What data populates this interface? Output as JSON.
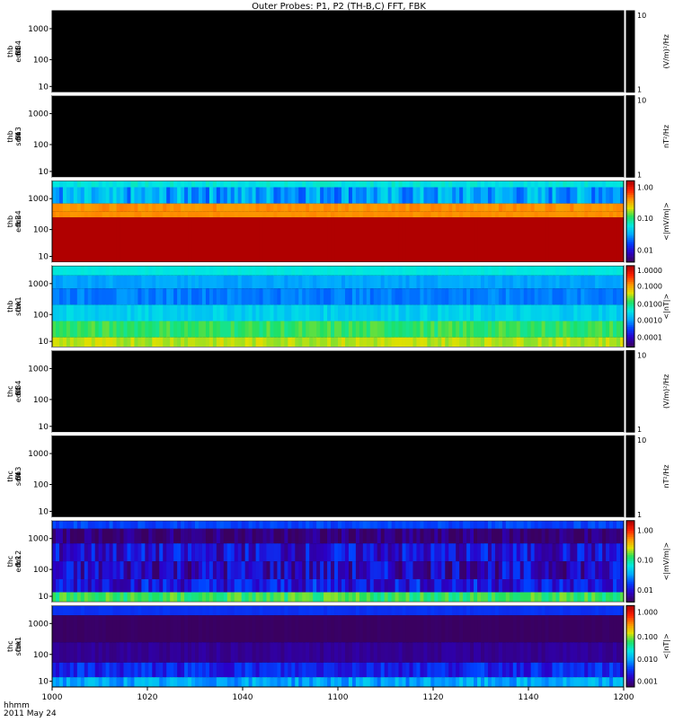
{
  "title": "Outer Probes: P1, P2 (TH-B,C) FFT, FBK",
  "footer": {
    "time_label": "hhmm",
    "date_label": "2011 May 24"
  },
  "colors": {
    "background": "#000000",
    "separator": "#ffffff",
    "colormap": [
      "#3a0060",
      "#2a00c8",
      "#0040ff",
      "#00a8ff",
      "#00e8e0",
      "#20e060",
      "#e0e000",
      "#ff9000",
      "#ff2000",
      "#b00000"
    ]
  },
  "chart_data": {
    "type": "heatmap",
    "x_axis": {
      "range": [
        "1000",
        "1200"
      ],
      "tick_labels": [
        "1000",
        "1020",
        "1040",
        "1100",
        "1120",
        "1140",
        "1200"
      ]
    },
    "panels": [
      {
        "id": "thb-fff-edc34",
        "ylabel": [
          "thb",
          "fff",
          "64",
          "edc34"
        ],
        "yscale": "log",
        "yticks": [
          "1000",
          "100",
          "10"
        ],
        "colorbar": {
          "label": "(V/m)²/Hz",
          "tick_labels": [
            "10",
            "1"
          ],
          "tick_fracs": [
            0.0,
            1.0
          ],
          "gradient": false
        },
        "data": "empty"
      },
      {
        "id": "thb-fff-scm3",
        "ylabel": [
          "thb",
          "fff",
          "64",
          "scm3"
        ],
        "yscale": "log",
        "yticks": [
          "1000",
          "100",
          "10"
        ],
        "colorbar": {
          "label": "nT²/Hz",
          "tick_labels": [
            "10",
            "1"
          ],
          "tick_fracs": [
            0.0,
            1.0
          ],
          "gradient": false
        },
        "data": "empty"
      },
      {
        "id": "thb-fbk-edc34",
        "ylabel": [
          "thb",
          "fbk",
          "edc34"
        ],
        "yscale": "log",
        "yticks": [
          "1000",
          "100",
          "10"
        ],
        "colorbar": {
          "label": "<|mV/m|>",
          "tick_labels": [
            "1.00",
            "0.10",
            "0.01"
          ],
          "tick_fracs": [
            0.08,
            0.46,
            0.85
          ],
          "gradient": true
        },
        "bands": [
          {
            "from": 0.0,
            "to": 0.08,
            "color_index": 4,
            "variation": 0.3
          },
          {
            "from": 0.08,
            "to": 0.28,
            "color_index": 3,
            "variation": 0.9
          },
          {
            "from": 0.28,
            "to": 0.38,
            "color_index": 7,
            "variation": 0.2
          },
          {
            "from": 0.38,
            "to": 0.45,
            "color_index": 7,
            "variation": 0.1
          },
          {
            "from": 0.45,
            "to": 1.0,
            "color_index": 9,
            "variation": 0.0
          }
        ]
      },
      {
        "id": "thb-fbk-scm1",
        "ylabel": [
          "thb",
          "fbk",
          "scm1"
        ],
        "yscale": "log",
        "yticks": [
          "1000",
          "100",
          "10"
        ],
        "colorbar": {
          "label": "<|nT|>",
          "tick_labels": [
            "1.0000",
            "0.1000",
            "0.0100",
            "0.0010",
            "0.0001"
          ],
          "tick_fracs": [
            0.05,
            0.25,
            0.47,
            0.67,
            0.88
          ],
          "gradient": true
        },
        "bands": [
          {
            "from": 0.0,
            "to": 0.12,
            "color_index": 4,
            "variation": 0.1
          },
          {
            "from": 0.12,
            "to": 0.28,
            "color_index": 3,
            "variation": 0.2
          },
          {
            "from": 0.28,
            "to": 0.48,
            "color_index": 2.6,
            "variation": 0.3
          },
          {
            "from": 0.48,
            "to": 0.68,
            "color_index": 3.6,
            "variation": 0.3
          },
          {
            "from": 0.68,
            "to": 0.88,
            "color_index": 5,
            "variation": 0.4
          },
          {
            "from": 0.88,
            "to": 1.0,
            "color_index": 5.8,
            "variation": 0.3
          }
        ]
      },
      {
        "id": "thc-fff-edc34",
        "ylabel": [
          "thc",
          "fff",
          "64",
          "edc34"
        ],
        "yscale": "log",
        "yticks": [
          "1000",
          "100",
          "10"
        ],
        "colorbar": {
          "label": "(V/m)²/Hz",
          "tick_labels": [
            "10",
            "1"
          ],
          "tick_fracs": [
            0.0,
            1.0
          ],
          "gradient": false
        },
        "data": "empty"
      },
      {
        "id": "thc-fff-scm3",
        "ylabel": [
          "thc",
          "fff",
          "64",
          "scm3"
        ],
        "yscale": "log",
        "yticks": [
          "1000",
          "100",
          "10"
        ],
        "colorbar": {
          "label": "nT²/Hz",
          "tick_labels": [
            "10",
            "1"
          ],
          "tick_fracs": [
            0.0,
            1.0
          ],
          "gradient": false
        },
        "data": "empty"
      },
      {
        "id": "thc-fbk-edc12",
        "ylabel": [
          "thc",
          "fbk",
          "edc12"
        ],
        "yscale": "log",
        "yticks": [
          "1000",
          "100",
          "10"
        ],
        "colorbar": {
          "label": "<|mV/m|>",
          "tick_labels": [
            "1.00",
            "0.10",
            "0.01"
          ],
          "tick_fracs": [
            0.12,
            0.48,
            0.85
          ],
          "gradient": true
        },
        "bands": [
          {
            "from": 0.0,
            "to": 0.1,
            "color_index": 2,
            "variation": 0.3
          },
          {
            "from": 0.1,
            "to": 0.28,
            "color_index": 0.2,
            "variation": 0.6
          },
          {
            "from": 0.28,
            "to": 0.5,
            "color_index": 1.2,
            "variation": 0.9
          },
          {
            "from": 0.5,
            "to": 0.72,
            "color_index": 1.0,
            "variation": 1.0
          },
          {
            "from": 0.72,
            "to": 0.88,
            "color_index": 1.4,
            "variation": 0.9
          },
          {
            "from": 0.88,
            "to": 1.0,
            "color_index": 5,
            "variation": 0.6
          }
        ]
      },
      {
        "id": "thc-fbk-scm1",
        "ylabel": [
          "thc",
          "fbk",
          "scm1"
        ],
        "yscale": "log",
        "yticks": [
          "1000",
          "100",
          "10"
        ],
        "colorbar": {
          "label": "<|nT|>",
          "tick_labels": [
            "1.000",
            "0.100",
            "0.010",
            "0.001"
          ],
          "tick_fracs": [
            0.08,
            0.38,
            0.66,
            0.93
          ],
          "gradient": true
        },
        "bands": [
          {
            "from": 0.0,
            "to": 0.12,
            "color_index": 1.8,
            "variation": 0.1
          },
          {
            "from": 0.12,
            "to": 0.45,
            "color_index": 0.0,
            "variation": 0.1
          },
          {
            "from": 0.45,
            "to": 0.7,
            "color_index": 0.5,
            "variation": 0.2
          },
          {
            "from": 0.7,
            "to": 0.88,
            "color_index": 1.6,
            "variation": 0.6
          },
          {
            "from": 0.88,
            "to": 1.0,
            "color_index": 3.0,
            "variation": 0.6
          }
        ]
      }
    ]
  }
}
